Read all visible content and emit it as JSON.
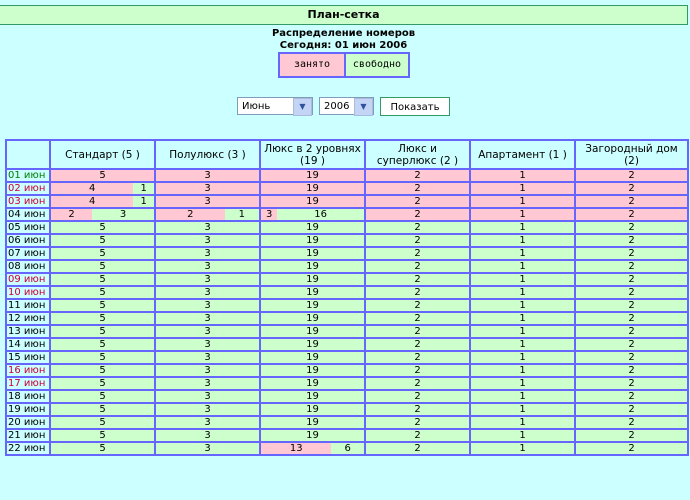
{
  "header": {
    "title": "План-сетка"
  },
  "subtitle": {
    "line1": "Распределение номеров",
    "line2": "Сегодня: 01 июн 2006"
  },
  "legend": {
    "busy": "занято",
    "free": "свободно"
  },
  "controls": {
    "month": "Июнь",
    "year": "2006",
    "show_label": "Показать"
  },
  "colors": {
    "busy": "#ffc8d2",
    "free": "#ccffcc",
    "border": "#6666ff",
    "background": "#ccffff"
  },
  "table": {
    "columns": [
      "",
      "Стандарт (5 )",
      "Полулюкс (3 )",
      "Люкс в 2 уровнях (19 )",
      "Люкс и суперлюкс (2 )",
      "Апартамент (1 )",
      "Загородный дом (2)"
    ],
    "rows": [
      {
        "date": "01 июн",
        "tone": "green",
        "cells": [
          {
            "busy": "5"
          },
          {
            "busy": "3"
          },
          {
            "busy": "19"
          },
          {
            "busy": "2"
          },
          {
            "busy": "1"
          },
          {
            "busy": "2"
          }
        ]
      },
      {
        "date": "02 июн",
        "tone": "red",
        "cells": [
          {
            "busy": "4",
            "free": "1"
          },
          {
            "busy": "3"
          },
          {
            "busy": "19"
          },
          {
            "busy": "2"
          },
          {
            "busy": "1"
          },
          {
            "busy": "2"
          }
        ]
      },
      {
        "date": "03 июн",
        "tone": "red",
        "cells": [
          {
            "busy": "4",
            "free": "1"
          },
          {
            "busy": "3"
          },
          {
            "busy": "19"
          },
          {
            "busy": "2"
          },
          {
            "busy": "1"
          },
          {
            "busy": "2"
          }
        ]
      },
      {
        "date": "04 июн",
        "tone": "",
        "cells": [
          {
            "busy": "2",
            "free": "3"
          },
          {
            "busy": "2",
            "free": "1"
          },
          {
            "busy": "3",
            "free": "16"
          },
          {
            "busy": "2"
          },
          {
            "busy": "1"
          },
          {
            "busy": "2"
          }
        ]
      },
      {
        "date": "05 июн",
        "tone": "",
        "cells": [
          {
            "free": "5"
          },
          {
            "free": "3"
          },
          {
            "free": "19"
          },
          {
            "free": "2"
          },
          {
            "free": "1"
          },
          {
            "free": "2"
          }
        ]
      },
      {
        "date": "06 июн",
        "tone": "",
        "cells": [
          {
            "free": "5"
          },
          {
            "free": "3"
          },
          {
            "free": "19"
          },
          {
            "free": "2"
          },
          {
            "free": "1"
          },
          {
            "free": "2"
          }
        ]
      },
      {
        "date": "07 июн",
        "tone": "",
        "cells": [
          {
            "free": "5"
          },
          {
            "free": "3"
          },
          {
            "free": "19"
          },
          {
            "free": "2"
          },
          {
            "free": "1"
          },
          {
            "free": "2"
          }
        ]
      },
      {
        "date": "08 июн",
        "tone": "",
        "cells": [
          {
            "free": "5"
          },
          {
            "free": "3"
          },
          {
            "free": "19"
          },
          {
            "free": "2"
          },
          {
            "free": "1"
          },
          {
            "free": "2"
          }
        ]
      },
      {
        "date": "09 июн",
        "tone": "red",
        "cells": [
          {
            "free": "5"
          },
          {
            "free": "3"
          },
          {
            "free": "19"
          },
          {
            "free": "2"
          },
          {
            "free": "1"
          },
          {
            "free": "2"
          }
        ]
      },
      {
        "date": "10 июн",
        "tone": "red",
        "cells": [
          {
            "free": "5"
          },
          {
            "free": "3"
          },
          {
            "free": "19"
          },
          {
            "free": "2"
          },
          {
            "free": "1"
          },
          {
            "free": "2"
          }
        ]
      },
      {
        "date": "11 июн",
        "tone": "",
        "cells": [
          {
            "free": "5"
          },
          {
            "free": "3"
          },
          {
            "free": "19"
          },
          {
            "free": "2"
          },
          {
            "free": "1"
          },
          {
            "free": "2"
          }
        ]
      },
      {
        "date": "12 июн",
        "tone": "",
        "cells": [
          {
            "free": "5"
          },
          {
            "free": "3"
          },
          {
            "free": "19"
          },
          {
            "free": "2"
          },
          {
            "free": "1"
          },
          {
            "free": "2"
          }
        ]
      },
      {
        "date": "13 июн",
        "tone": "",
        "cells": [
          {
            "free": "5"
          },
          {
            "free": "3"
          },
          {
            "free": "19"
          },
          {
            "free": "2"
          },
          {
            "free": "1"
          },
          {
            "free": "2"
          }
        ]
      },
      {
        "date": "14 июн",
        "tone": "",
        "cells": [
          {
            "free": "5"
          },
          {
            "free": "3"
          },
          {
            "free": "19"
          },
          {
            "free": "2"
          },
          {
            "free": "1"
          },
          {
            "free": "2"
          }
        ]
      },
      {
        "date": "15 июн",
        "tone": "",
        "cells": [
          {
            "free": "5"
          },
          {
            "free": "3"
          },
          {
            "free": "19"
          },
          {
            "free": "2"
          },
          {
            "free": "1"
          },
          {
            "free": "2"
          }
        ]
      },
      {
        "date": "16 июн",
        "tone": "red",
        "cells": [
          {
            "free": "5"
          },
          {
            "free": "3"
          },
          {
            "free": "19"
          },
          {
            "free": "2"
          },
          {
            "free": "1"
          },
          {
            "free": "2"
          }
        ]
      },
      {
        "date": "17 июн",
        "tone": "red",
        "cells": [
          {
            "free": "5"
          },
          {
            "free": "3"
          },
          {
            "free": "19"
          },
          {
            "free": "2"
          },
          {
            "free": "1"
          },
          {
            "free": "2"
          }
        ]
      },
      {
        "date": "18 июн",
        "tone": "",
        "cells": [
          {
            "free": "5"
          },
          {
            "free": "3"
          },
          {
            "free": "19"
          },
          {
            "free": "2"
          },
          {
            "free": "1"
          },
          {
            "free": "2"
          }
        ]
      },
      {
        "date": "19 июн",
        "tone": "",
        "cells": [
          {
            "free": "5"
          },
          {
            "free": "3"
          },
          {
            "free": "19"
          },
          {
            "free": "2"
          },
          {
            "free": "1"
          },
          {
            "free": "2"
          }
        ]
      },
      {
        "date": "20 июн",
        "tone": "",
        "cells": [
          {
            "free": "5"
          },
          {
            "free": "3"
          },
          {
            "free": "19"
          },
          {
            "free": "2"
          },
          {
            "free": "1"
          },
          {
            "free": "2"
          }
        ]
      },
      {
        "date": "21 июн",
        "tone": "",
        "cells": [
          {
            "free": "5"
          },
          {
            "free": "3"
          },
          {
            "free": "19"
          },
          {
            "free": "2"
          },
          {
            "free": "1"
          },
          {
            "free": "2"
          }
        ]
      },
      {
        "date": "22 июн",
        "tone": "",
        "cells": [
          {
            "free": "5"
          },
          {
            "free": "3"
          },
          {
            "busy": "13",
            "free": "6"
          },
          {
            "free": "2"
          },
          {
            "free": "1"
          },
          {
            "free": "2"
          }
        ]
      }
    ]
  }
}
